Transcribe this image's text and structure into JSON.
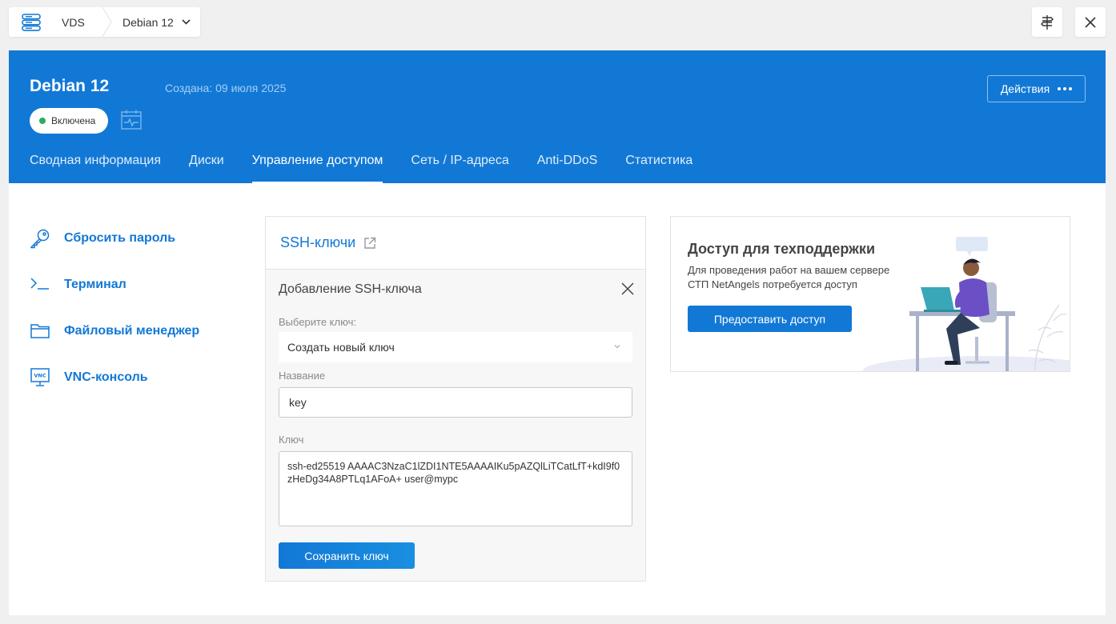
{
  "breadcrumb": {
    "service": "VDS",
    "server": "Debian 12"
  },
  "header": {
    "server_name": "Debian 12",
    "created": "Создана: 09 июля 2025",
    "status": "Включена",
    "actions_label": "Действия",
    "tabs": [
      {
        "label": "Сводная информация",
        "active": false
      },
      {
        "label": "Диски",
        "active": false
      },
      {
        "label": "Управление доступом",
        "active": true
      },
      {
        "label": "Сеть / IP-адреса",
        "active": false
      },
      {
        "label": "Anti-DDoS",
        "active": false
      },
      {
        "label": "Статистика",
        "active": false
      }
    ]
  },
  "sidebar": {
    "items": [
      {
        "label": "Сбросить пароль",
        "icon": "key-icon"
      },
      {
        "label": "Терминал",
        "icon": "terminal-icon"
      },
      {
        "label": "Файловый менеджер",
        "icon": "folder-icon"
      },
      {
        "label": "VNC-консоль",
        "icon": "vnc-icon"
      }
    ]
  },
  "ssh": {
    "title": "SSH-ключи",
    "form_title": "Добавление SSH-ключа",
    "select_label": "Выберите ключ:",
    "select_value": "Создать новый ключ",
    "name_label": "Название",
    "name_value": "key",
    "key_label": "Ключ",
    "key_value": "ssh-ed25519 AAAAC3NzaC1lZDI1NTE5AAAAIKu5pAZQlLiTCatLfT+kdI9f0zHeDg34A8PTLq1AFoA+ user@mypc",
    "save_label": "Сохранить ключ"
  },
  "support": {
    "title": "Доступ для техподдержки",
    "text": "Для проведения работ на вашем сервере СТП NetAngels потребуется доступ",
    "button": "Предоставить доступ"
  },
  "colors": {
    "accent": "#1278d6",
    "status": "#27ae60"
  }
}
